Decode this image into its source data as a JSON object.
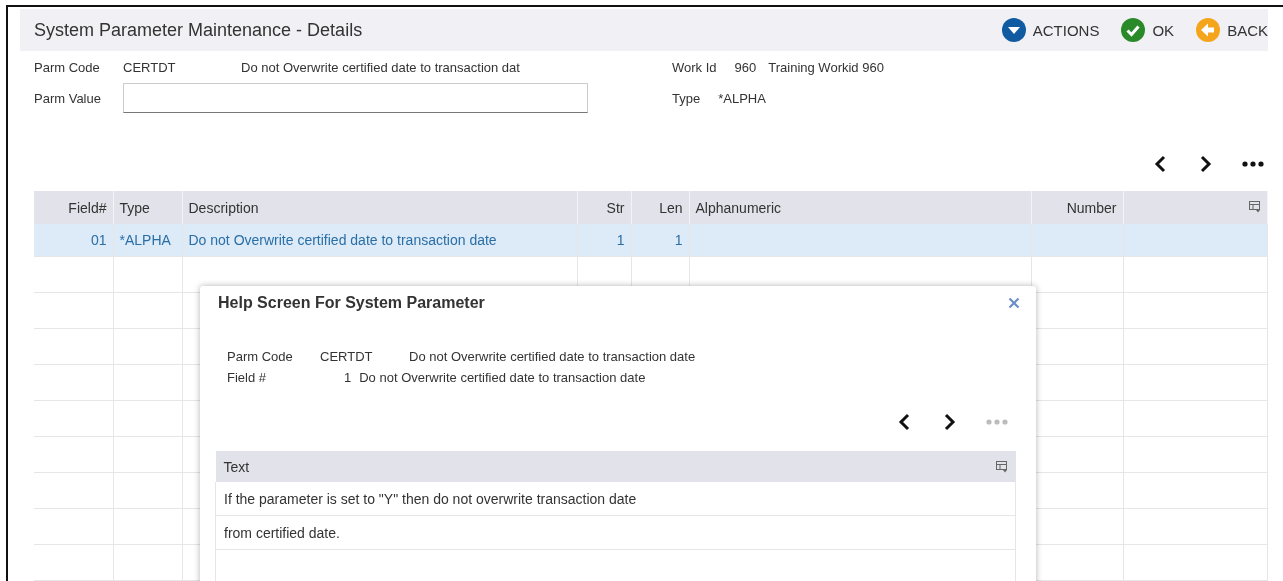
{
  "header": {
    "title": "System Parameter Maintenance - Details",
    "actions": [
      {
        "label": "ACTIONS",
        "kind": "menu"
      },
      {
        "label": "OK",
        "kind": "confirm"
      },
      {
        "label": "BACK",
        "kind": "back"
      }
    ]
  },
  "details": {
    "parm_code_label": "Parm Code",
    "parm_code": "CERTDT",
    "parm_description": "Do not Overwrite certified date to transaction dat",
    "parm_value_label": "Parm Value",
    "work_id_label": "Work Id",
    "work_id": "960",
    "work_name": "Training Workid 960",
    "type_label": "Type",
    "type": "*ALPHA"
  },
  "pager": {
    "more_disabled": false
  },
  "grid": {
    "columns": [
      {
        "label": "Field#",
        "kind": "number"
      },
      {
        "label": "Type",
        "kind": "text"
      },
      {
        "label": "Description",
        "kind": "text"
      },
      {
        "label": "Str",
        "kind": "number"
      },
      {
        "label": "Len",
        "kind": "number"
      },
      {
        "label": "Alphanumeric",
        "kind": "text"
      },
      {
        "label": "Number",
        "kind": "number"
      }
    ],
    "rows": [
      {
        "selected": true,
        "cells": [
          "01",
          "*ALPHA",
          "Do not Overwrite certified date to transaction date",
          "1",
          "1",
          null,
          null
        ]
      }
    ]
  },
  "help_dialog": {
    "title": "Help Screen For System Parameter",
    "parm_code_label": "Parm Code",
    "parm_code": "CERTDT",
    "parm_description": "Do not Overwrite certified date to transaction date",
    "field_label": "Field #",
    "field_no": "1",
    "field_description": "Do not Overwrite certified date to transaction date",
    "pager": {
      "more_disabled": true
    },
    "text_grid": {
      "column": "Text",
      "rows": [
        "If the parameter is set to \"Y\" then do not overwrite transaction date",
        "from certified date."
      ]
    }
  }
}
